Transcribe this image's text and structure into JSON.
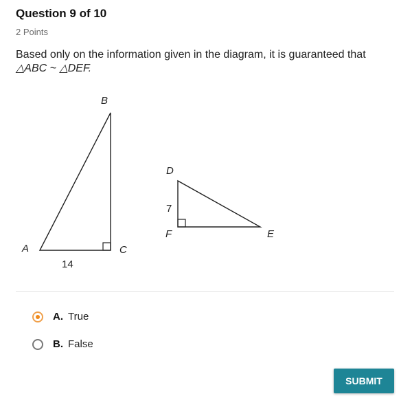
{
  "header": {
    "title": "Question 9 of 10",
    "points": "2 Points"
  },
  "question": {
    "text": "Based only on the information given in the diagram, it is guaranteed that",
    "math": "△ABC ~ △DEF."
  },
  "diagram": {
    "triangle_abc": {
      "vertices": [
        "A",
        "B",
        "C"
      ],
      "right_angle_at": "C",
      "side_labels": {
        "AC": "14"
      }
    },
    "triangle_def": {
      "vertices": [
        "D",
        "E",
        "F"
      ],
      "right_angle_at": "F",
      "side_labels": {
        "DF": "7"
      }
    }
  },
  "options": [
    {
      "letter": "A.",
      "text": "True",
      "selected": true
    },
    {
      "letter": "B.",
      "text": "False",
      "selected": false
    }
  ],
  "submit_label": "SUBMIT",
  "colors": {
    "accent_selected": "#f08a1c",
    "submit_bg": "#1e8596"
  }
}
